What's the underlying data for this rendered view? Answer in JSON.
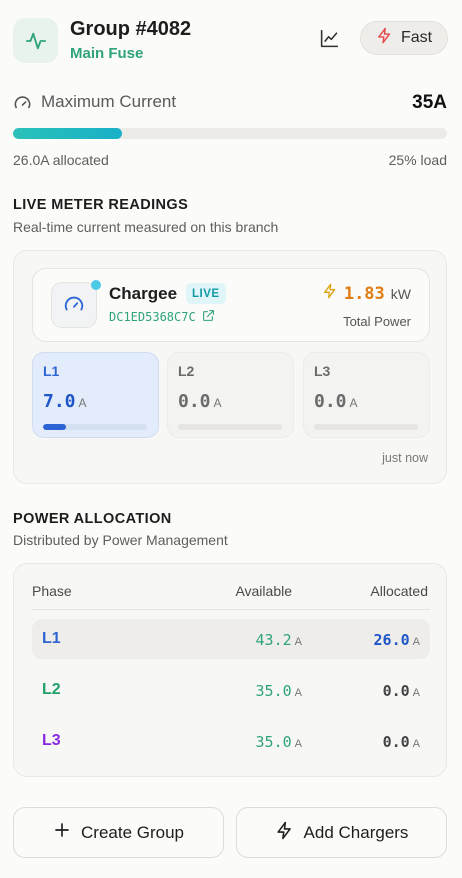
{
  "header": {
    "title": "Group #4082",
    "subtitle": "Main Fuse",
    "fast_label": "Fast",
    "icons": {
      "group": "activity-icon",
      "chart": "line-chart-icon",
      "fast": "zap-icon"
    }
  },
  "max_current": {
    "label": "Maximum Current",
    "value": "35A",
    "allocated_text": "26.0A allocated",
    "load_text": "25% load",
    "load_fraction": 0.25
  },
  "live_meter": {
    "title": "LIVE METER READINGS",
    "subtitle": "Real-time current measured on this branch",
    "charger": {
      "name": "Chargee",
      "badge": "LIVE",
      "id": "DC1ED5368C7C",
      "power_value": "1.83",
      "power_unit": "kW",
      "power_label": "Total Power"
    },
    "phases": [
      {
        "name": "L1",
        "value": "7.0",
        "unit": "A",
        "fill_fraction": 0.22,
        "active": true
      },
      {
        "name": "L2",
        "value": "0.0",
        "unit": "A",
        "fill_fraction": 0,
        "active": false
      },
      {
        "name": "L3",
        "value": "0.0",
        "unit": "A",
        "fill_fraction": 0,
        "active": false
      }
    ],
    "updated": "just now"
  },
  "power_allocation": {
    "title": "POWER ALLOCATION",
    "subtitle": "Distributed by Power Management",
    "headers": {
      "phase": "Phase",
      "available": "Available",
      "allocated": "Allocated"
    },
    "rows": [
      {
        "phase": "L1",
        "available": "43.2",
        "allocated": "26.0",
        "unit": "A",
        "color": "#2f65d3",
        "alloc_color": "#1f57c8"
      },
      {
        "phase": "L2",
        "available": "35.0",
        "allocated": "0.0",
        "unit": "A",
        "color": "#21a06a",
        "alloc_color": "#444444"
      },
      {
        "phase": "L3",
        "available": "35.0",
        "allocated": "0.0",
        "unit": "A",
        "color": "#8a2be2",
        "alloc_color": "#444444"
      }
    ]
  },
  "actions": {
    "create_group": "Create Group",
    "add_chargers": "Add Chargers"
  },
  "colors": {
    "accent_green": "#2fa47a",
    "progress": "#18b0c8",
    "power_orange": "#e07d12",
    "fast_red": "#e04848"
  }
}
